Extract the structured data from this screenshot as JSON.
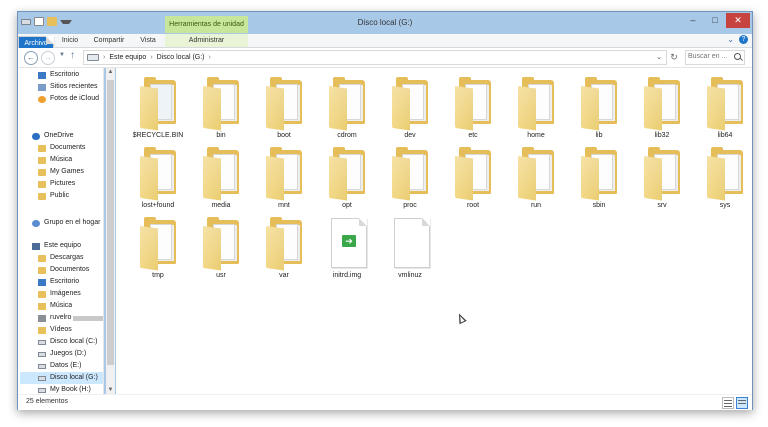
{
  "window": {
    "title": "Disco local (G:)",
    "close_glyph": "✕",
    "min_glyph": "‒",
    "max_glyph": "□"
  },
  "ribbon": {
    "contextual_group_label": "Herramientas de unidad",
    "tabs": [
      "Archivo",
      "Inicio",
      "Compartir",
      "Vista",
      "Administrar"
    ],
    "expand_glyph": "⌄",
    "help_glyph": "?"
  },
  "address": {
    "breadcrumbs": [
      "Este equipo",
      "Disco local (G:)"
    ],
    "separator": "›",
    "dropdown_glyph": "⌄",
    "refresh_glyph": "↻"
  },
  "search": {
    "placeholder": "Buscar en ..."
  },
  "nav_pane": {
    "favorites": [
      {
        "label": "Escritorio",
        "icon": "desktop-icon"
      },
      {
        "label": "Sitios recientes",
        "icon": "recent-places-icon"
      },
      {
        "label": "Fotos de iCloud",
        "icon": "icloud-photos-icon"
      }
    ],
    "onedrive_label": "OneDrive",
    "onedrive_children": [
      "Documents",
      "Música",
      "My Games",
      "Pictures",
      "Public"
    ],
    "homegroup_label": "Grupo en el hogar",
    "thispc_label": "Este equipo",
    "thispc_children": [
      {
        "label": "Descargas",
        "icon": "downloads-icon"
      },
      {
        "label": "Documentos",
        "icon": "documents-icon"
      },
      {
        "label": "Escritorio",
        "icon": "desktop-icon"
      },
      {
        "label": "Imágenes",
        "icon": "pictures-icon"
      },
      {
        "label": "Música",
        "icon": "music-icon"
      },
      {
        "label": "ruvelro",
        "icon": "user-folder-icon"
      },
      {
        "label": "Vídeos",
        "icon": "videos-icon"
      },
      {
        "label": "Disco local (C:)",
        "icon": "drive-icon"
      },
      {
        "label": "Juegos (D:)",
        "icon": "drive-icon"
      },
      {
        "label": "Datos (E:)",
        "icon": "drive-icon"
      },
      {
        "label": "Disco local (G:)",
        "icon": "drive-icon"
      },
      {
        "label": "My Book (H:)",
        "icon": "drive-icon"
      }
    ],
    "selected_item": "Disco local (G:)"
  },
  "content": {
    "items": [
      {
        "name": "$RECYCLE.BIN",
        "kind": "folder",
        "icon": "recycle-bin-folder-icon"
      },
      {
        "name": "bin",
        "kind": "folder",
        "icon": "folder-icon"
      },
      {
        "name": "boot",
        "kind": "folder",
        "icon": "folder-icon"
      },
      {
        "name": "cdrom",
        "kind": "folder",
        "icon": "folder-icon"
      },
      {
        "name": "dev",
        "kind": "folder",
        "icon": "folder-icon"
      },
      {
        "name": "etc",
        "kind": "folder",
        "icon": "folder-icon"
      },
      {
        "name": "home",
        "kind": "folder",
        "icon": "folder-icon"
      },
      {
        "name": "lib",
        "kind": "folder",
        "icon": "folder-icon"
      },
      {
        "name": "lib32",
        "kind": "folder",
        "icon": "folder-icon"
      },
      {
        "name": "lib64",
        "kind": "folder",
        "icon": "folder-icon"
      },
      {
        "name": "lost+found",
        "kind": "folder",
        "icon": "folder-icon"
      },
      {
        "name": "media",
        "kind": "folder",
        "icon": "folder-icon"
      },
      {
        "name": "mnt",
        "kind": "folder",
        "icon": "folder-icon"
      },
      {
        "name": "opt",
        "kind": "folder",
        "icon": "folder-icon"
      },
      {
        "name": "proc",
        "kind": "folder",
        "icon": "folder-icon"
      },
      {
        "name": "root",
        "kind": "folder",
        "icon": "folder-icon"
      },
      {
        "name": "run",
        "kind": "folder",
        "icon": "folder-icon"
      },
      {
        "name": "sbin",
        "kind": "folder",
        "icon": "folder-icon"
      },
      {
        "name": "srv",
        "kind": "folder",
        "icon": "folder-icon"
      },
      {
        "name": "sys",
        "kind": "folder",
        "icon": "folder-icon"
      },
      {
        "name": "tmp",
        "kind": "folder",
        "icon": "folder-icon"
      },
      {
        "name": "usr",
        "kind": "folder",
        "icon": "folder-icon"
      },
      {
        "name": "var",
        "kind": "folder",
        "icon": "folder-icon"
      },
      {
        "name": "initrd.img",
        "kind": "shortcut",
        "icon": "shortcut-file-icon"
      },
      {
        "name": "vmlinuz",
        "kind": "file",
        "icon": "file-icon"
      }
    ]
  },
  "status": {
    "item_count": "25 elementos"
  },
  "colors": {
    "file_tab": "#1e74c8",
    "contextual_tab": "#c8e69a",
    "close_button": "#c74340",
    "folder": "#e6be59",
    "selection": "#cce8ff"
  }
}
